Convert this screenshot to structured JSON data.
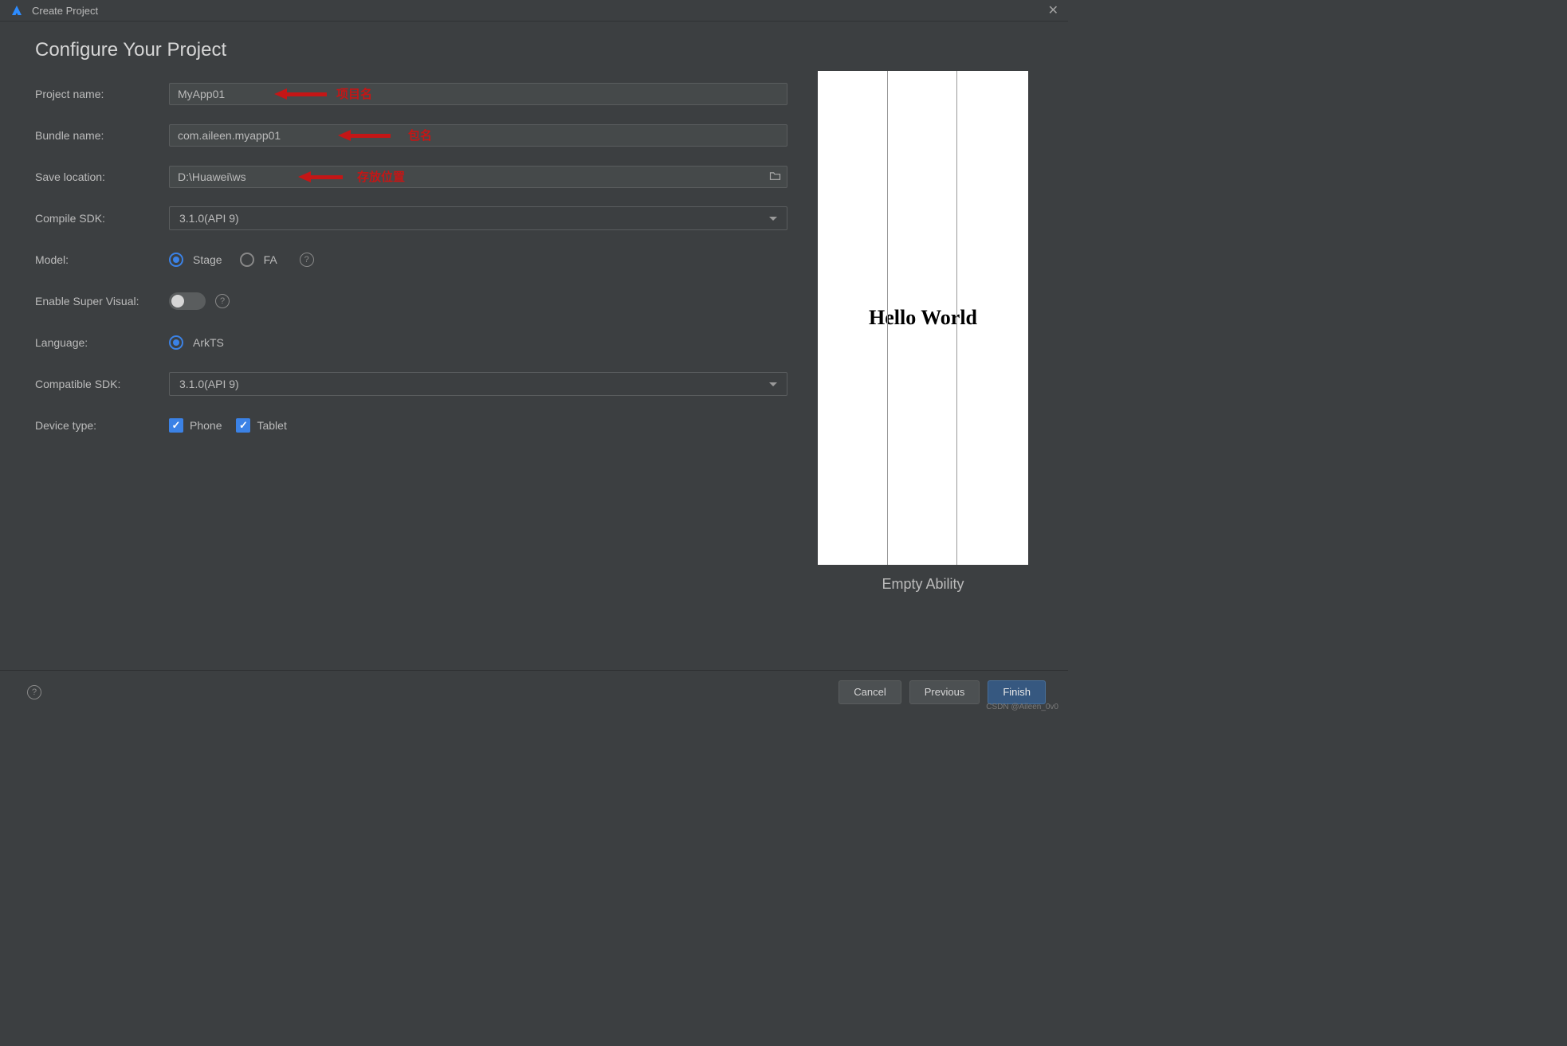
{
  "window": {
    "title": "Create Project"
  },
  "page_heading": "Configure Your Project",
  "labels": {
    "project_name": "Project name:",
    "bundle_name": "Bundle name:",
    "save_location": "Save location:",
    "compile_sdk": "Compile SDK:",
    "model": "Model:",
    "enable_super_visual": "Enable Super Visual:",
    "language": "Language:",
    "compatible_sdk": "Compatible SDK:",
    "device_type": "Device type:"
  },
  "values": {
    "project_name": "MyApp01",
    "bundle_name": "com.aileen.myapp01",
    "save_location": "D:\\Huawei\\ws",
    "compile_sdk": "3.1.0(API 9)",
    "compatible_sdk": "3.1.0(API 9)"
  },
  "model_options": {
    "stage": "Stage",
    "fa": "FA"
  },
  "language_option": "ArkTS",
  "device_options": {
    "phone": "Phone",
    "tablet": "Tablet"
  },
  "preview": {
    "text": "Hello World",
    "caption": "Empty Ability"
  },
  "annotations": {
    "project_name": "项目名",
    "bundle_name": "包名",
    "save_location": "存放位置"
  },
  "buttons": {
    "cancel": "Cancel",
    "previous": "Previous",
    "finish": "Finish"
  },
  "watermark": "CSDN @Aileen_0v0"
}
